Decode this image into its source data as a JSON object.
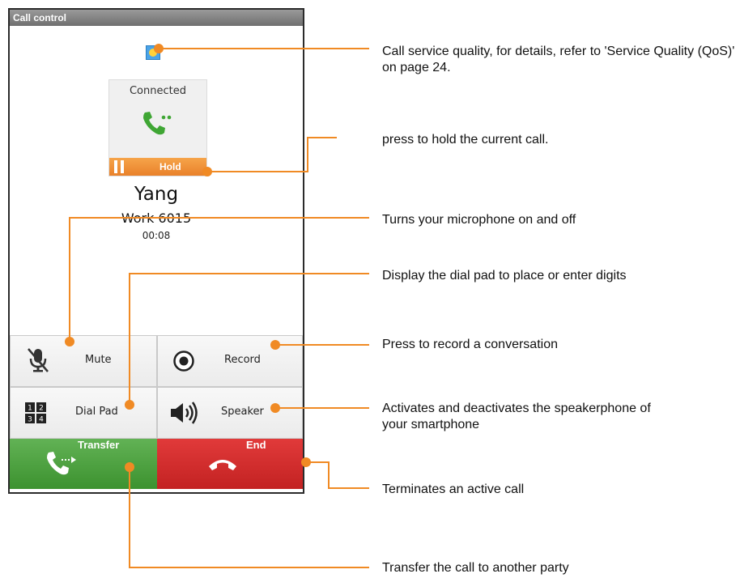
{
  "titlebar": {
    "title": "Call control"
  },
  "call": {
    "status": "Connected",
    "hold_label": "Hold",
    "caller_name": "Yang",
    "caller_number": "Work 6015",
    "duration": "00:08"
  },
  "buttons": {
    "mute": "Mute",
    "record": "Record",
    "dialpad": "Dial Pad",
    "speaker": "Speaker",
    "transfer": "Transfer",
    "end": "End"
  },
  "dialpad_icon_digits": [
    "1",
    "2",
    "3",
    "4"
  ],
  "annotations": {
    "qos": "Call service quality, for details, refer to 'Service Quality (QoS)' on page 24.",
    "hold": "press to hold the current call.",
    "mute": "Turns your microphone on and off",
    "dialpad": "Display the dial pad to place or enter digits",
    "record": "Press to record a conversation",
    "speaker": "Activates and deactivates the speakerphone of your smartphone",
    "end": "Terminates an active call",
    "transfer": "Transfer the call to another party"
  },
  "colors": {
    "callout_line": "#f08a24",
    "hold_bar": "#ef8f33",
    "transfer_bg": "#4ea143",
    "end_bg": "#d42e2e",
    "handset_green": "#3fa634"
  }
}
